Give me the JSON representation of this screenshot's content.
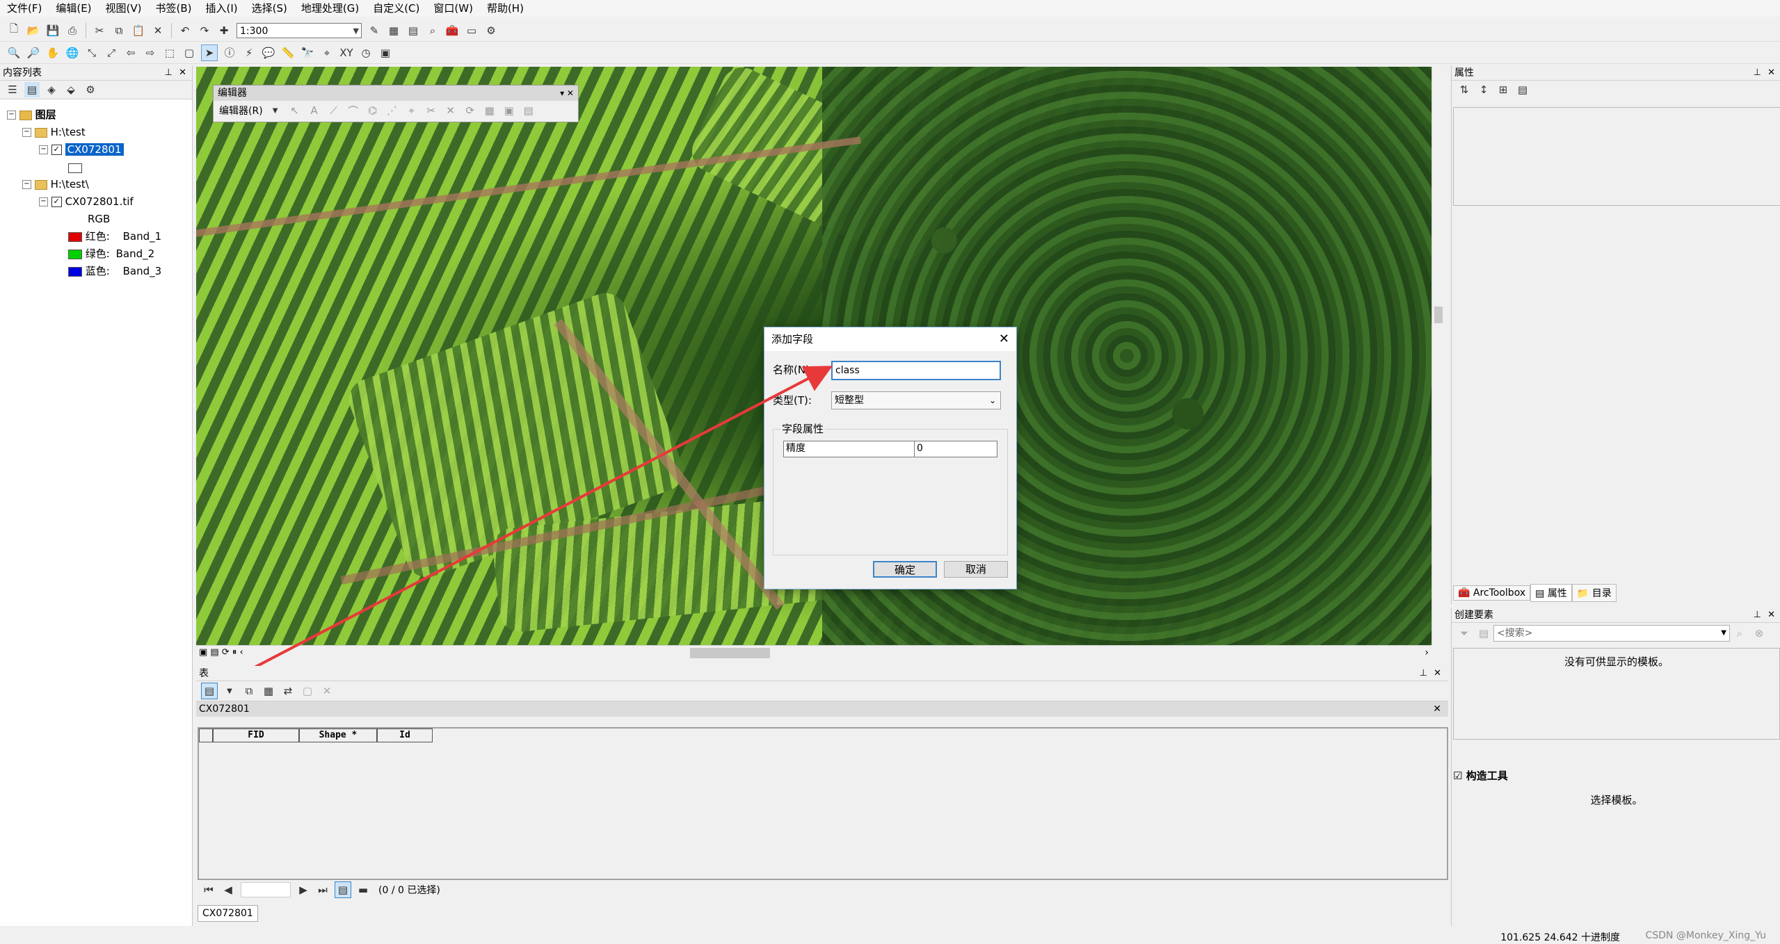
{
  "menu": [
    "文件(F)",
    "编辑(E)",
    "视图(V)",
    "书签(B)",
    "插入(I)",
    "选择(S)",
    "地理处理(G)",
    "自定义(C)",
    "窗口(W)",
    "帮助(H)"
  ],
  "toolbar": {
    "scale": "1:300"
  },
  "toc": {
    "title": "内容列表",
    "layers_label": "图层",
    "group1": "H:\\test",
    "layer1": "CX072801",
    "group2": "H:\\test\\",
    "layer2": "CX072801.tif",
    "rgb_label": "RGB",
    "bands": [
      {
        "color_name": "红色:",
        "band": "Band_1",
        "color": "#e00000"
      },
      {
        "color_name": "绿色:",
        "band": "Band_2",
        "color": "#00d000"
      },
      {
        "color_name": "蓝色:",
        "band": "Band_3",
        "color": "#0000e0"
      }
    ]
  },
  "editor": {
    "title": "编辑器",
    "menu": "编辑器(R)"
  },
  "dialog": {
    "title": "添加字段",
    "name_label": "名称(N):",
    "name_value": "class",
    "type_label": "类型(T):",
    "type_value": "短整型",
    "props_label": "字段属性",
    "precision_label": "精度",
    "precision_value": "0",
    "ok": "确定",
    "cancel": "取消"
  },
  "table": {
    "title": "表",
    "tab_name": "CX072801",
    "columns": [
      "FID",
      "Shape *",
      "Id"
    ],
    "record_status": "(0 / 0 已选择)",
    "bottom_tab": "CX072801"
  },
  "right": {
    "props_title": "属性",
    "tabs": [
      "ArcToolbox",
      "属性",
      "目录"
    ],
    "create_title": "创建要素",
    "search_placeholder": "<搜索>",
    "no_templates": "没有可供显示的模板。",
    "construct_title": "构造工具",
    "select_template": "选择模板。"
  },
  "status": {
    "coords": "101.625  24.642 十进制度",
    "watermark": "CSDN @Monkey_Xing_Yu"
  },
  "colors": {
    "accent": "#3b83c8",
    "arrow": "#e8393a",
    "selection": "#0a64c8"
  }
}
